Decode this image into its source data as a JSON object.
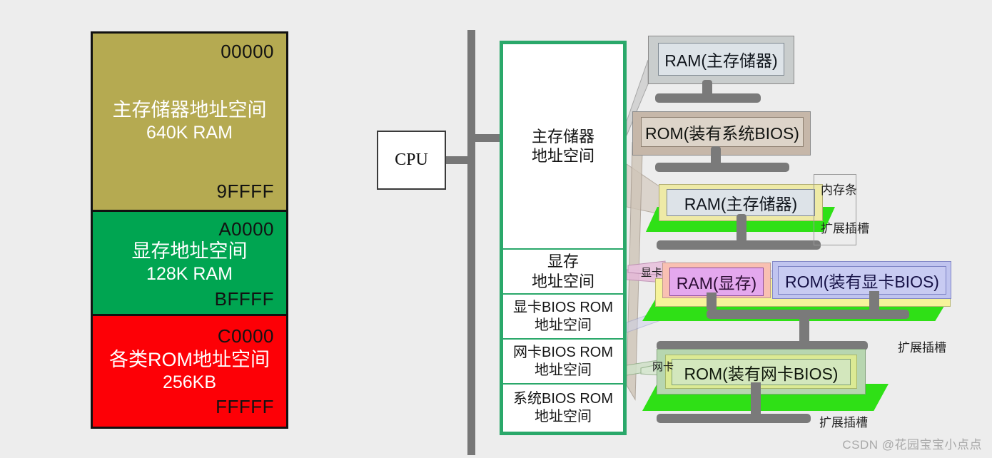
{
  "memory_map": {
    "blocks": [
      {
        "title": "主存储器地址空间",
        "subtitle": "640K RAM",
        "color": "#b5aa51",
        "start": "00000",
        "end": "9FFFF"
      },
      {
        "title": "显存地址空间",
        "subtitle": "128K RAM",
        "color": "#00a551",
        "start": "A0000",
        "end": "BFFFF"
      },
      {
        "title": "各类ROM地址空间",
        "subtitle": "256KB",
        "color": "#fd0006",
        "start": "C0000",
        "end": "FFFFF"
      }
    ],
    "addresses": [
      "00000",
      "9FFFF",
      "A0000",
      "BFFFF",
      "C0000",
      "FFFFF"
    ]
  },
  "cpu": {
    "label": "CPU"
  },
  "address_space_column": {
    "rows": [
      {
        "line1": "主存储器",
        "line2": "地址空间"
      },
      {
        "line1": "显存",
        "line2": "地址空间"
      },
      {
        "line1": "显卡BIOS ROM",
        "line2": "地址空间"
      },
      {
        "line1": "网卡BIOS ROM",
        "line2": "地址空间"
      },
      {
        "line1": "系统BIOS ROM",
        "line2": "地址空间"
      }
    ]
  },
  "hardware": {
    "ram_main": "RAM(主存储器)",
    "rom_system_bios": "ROM(装有系统BIOS)",
    "ram_module": "RAM(主存储器)",
    "ram_vram": "RAM(显存)",
    "rom_gpu_bios": "ROM(装有显卡BIOS)",
    "rom_nic_bios": "ROM(装有网卡BIOS)"
  },
  "annotations": {
    "memory_module": "内存条",
    "expansion_slot_1": "扩展插槽",
    "expansion_slot_2": "扩展插槽",
    "expansion_slot_3": "扩展插槽",
    "graphics_card": "显卡",
    "network_card": "网卡"
  },
  "watermark": "CSDN @花园宝宝小点点",
  "colors": {
    "main_memory": "#b5aa51",
    "video_memory": "#00a551",
    "rom_area": "#fd0006",
    "column_border": "#2aa86a",
    "bus": "#777777",
    "expansion_slot": "#2fe016"
  }
}
